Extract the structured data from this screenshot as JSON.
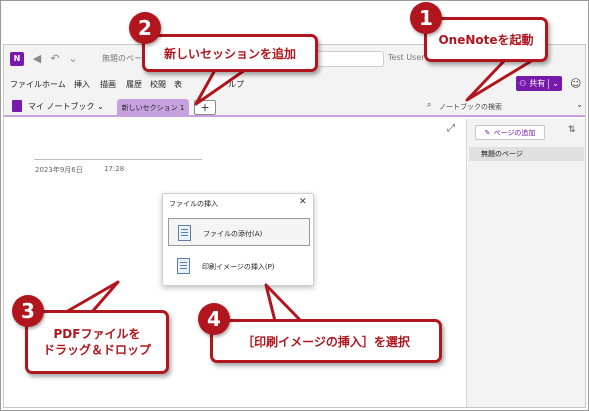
{
  "window": {
    "app_icon_letter": "N",
    "title": "無題のページ - On",
    "user": "Test User"
  },
  "menu": {
    "items": [
      "ファイル",
      "ホーム",
      "挿入",
      "描画",
      "履歴",
      "校閲",
      "表",
      "ルプ"
    ],
    "share_label": "共有",
    "share_icon": "person-plus-icon",
    "feedback_icon": "feedback-icon"
  },
  "notebook": {
    "name": "マイ ノートブック",
    "section_tab": "新しいセクション 1",
    "add_tab": "+",
    "search_placeholder": "ノートブックの検索"
  },
  "page": {
    "date": "2023年9月6日",
    "time": "17:28"
  },
  "pane": {
    "add_page": "ページの追加",
    "pages": [
      "無題のページ"
    ]
  },
  "dialog": {
    "title": "ファイルの挿入",
    "close": "✕",
    "options": [
      {
        "label": "ファイルの添付(A)"
      },
      {
        "label": "印刷イメージの挿入(P)"
      }
    ]
  },
  "callouts": [
    {
      "number": "1",
      "text": "OneNoteを起動"
    },
    {
      "number": "2",
      "text": "新しいセッションを追加"
    },
    {
      "number": "3",
      "text_line1": "PDFファイルを",
      "text_line2": "ドラッグ＆ドロップ"
    },
    {
      "number": "4",
      "text": "［印刷イメージの挿入］を選択"
    }
  ],
  "colors": {
    "accent": "#7719aa",
    "callout": "#b1151d",
    "section_tab": "#c8a2e0"
  }
}
